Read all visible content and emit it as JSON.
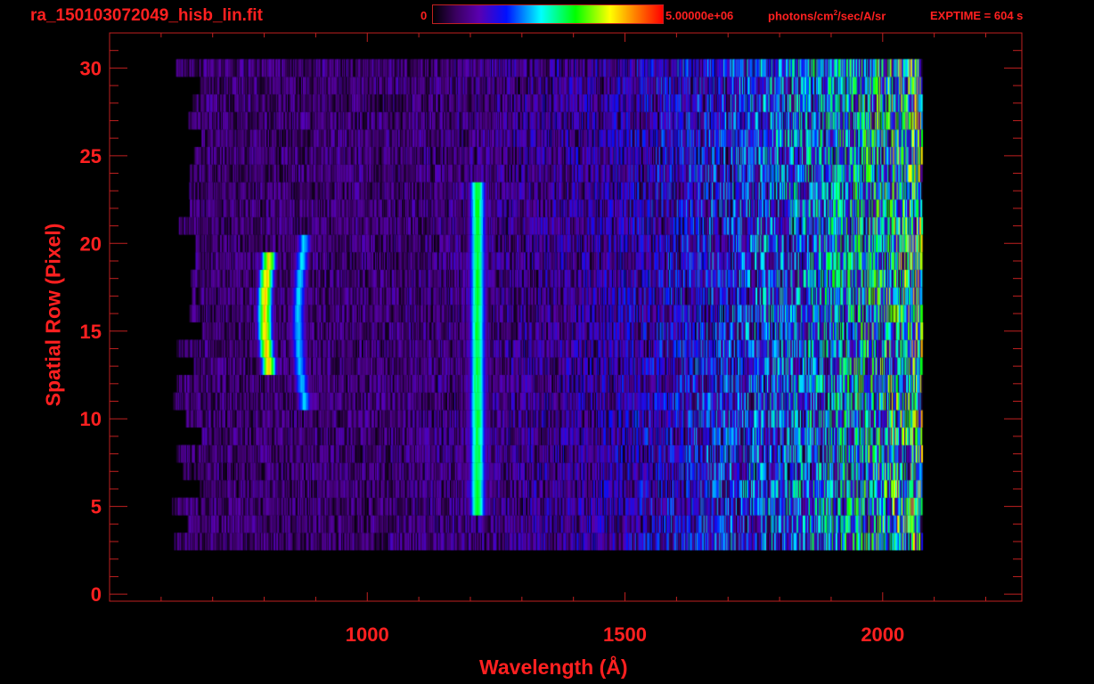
{
  "header": {
    "title": "ra_150103072049_hisb_lin.fit",
    "colorbar_min_label": "0",
    "colorbar_max_label": "5.00000e+06",
    "colorbar_unit_prefix": "photons/cm",
    "colorbar_unit_sup": "2",
    "colorbar_unit_suffix": "/sec/A/sr",
    "exptime": "EXPTIME = 604 s"
  },
  "chart_data": {
    "type": "heatmap",
    "title": "ra_150103072049_hisb_lin.fit",
    "xlabel": "Wavelength (Å)",
    "ylabel": "Spatial Row (Pixel)",
    "xlim": [
      500,
      2270
    ],
    "ylim": [
      -0.4,
      32
    ],
    "x_ticks": [
      1000,
      1500,
      2000
    ],
    "x_tick_labels": [
      "1000",
      "1500",
      "2000"
    ],
    "y_ticks": [
      0,
      5,
      10,
      15,
      20,
      25,
      30
    ],
    "y_tick_labels": [
      "0",
      "5",
      "10",
      "15",
      "20",
      "25",
      "30"
    ],
    "value_range": [
      0,
      5000000
    ],
    "value_unit": "photons/cm^2/sec/A/sr",
    "grid": false,
    "background": {
      "rows": [
        3,
        30
      ],
      "wavelength_range": [
        650,
        2075
      ],
      "level_start": 0.13,
      "level_end": 0.5
    },
    "features": [
      {
        "name": "line ~800 Å",
        "center_wavelength": 800,
        "rows": [
          13,
          19
        ],
        "peak_fraction": 0.82,
        "width": 14,
        "curvature": 8
      },
      {
        "name": "line ~870 Å",
        "center_wavelength": 865,
        "rows": [
          11,
          20
        ],
        "peak_fraction": 0.45,
        "width": 14,
        "curvature": 12
      },
      {
        "name": "Lyman-alpha 1216 Å",
        "center_wavelength": 1213,
        "rows": [
          5,
          23
        ],
        "peak_fraction": 0.6,
        "width": 16,
        "curvature": 0
      }
    ]
  }
}
